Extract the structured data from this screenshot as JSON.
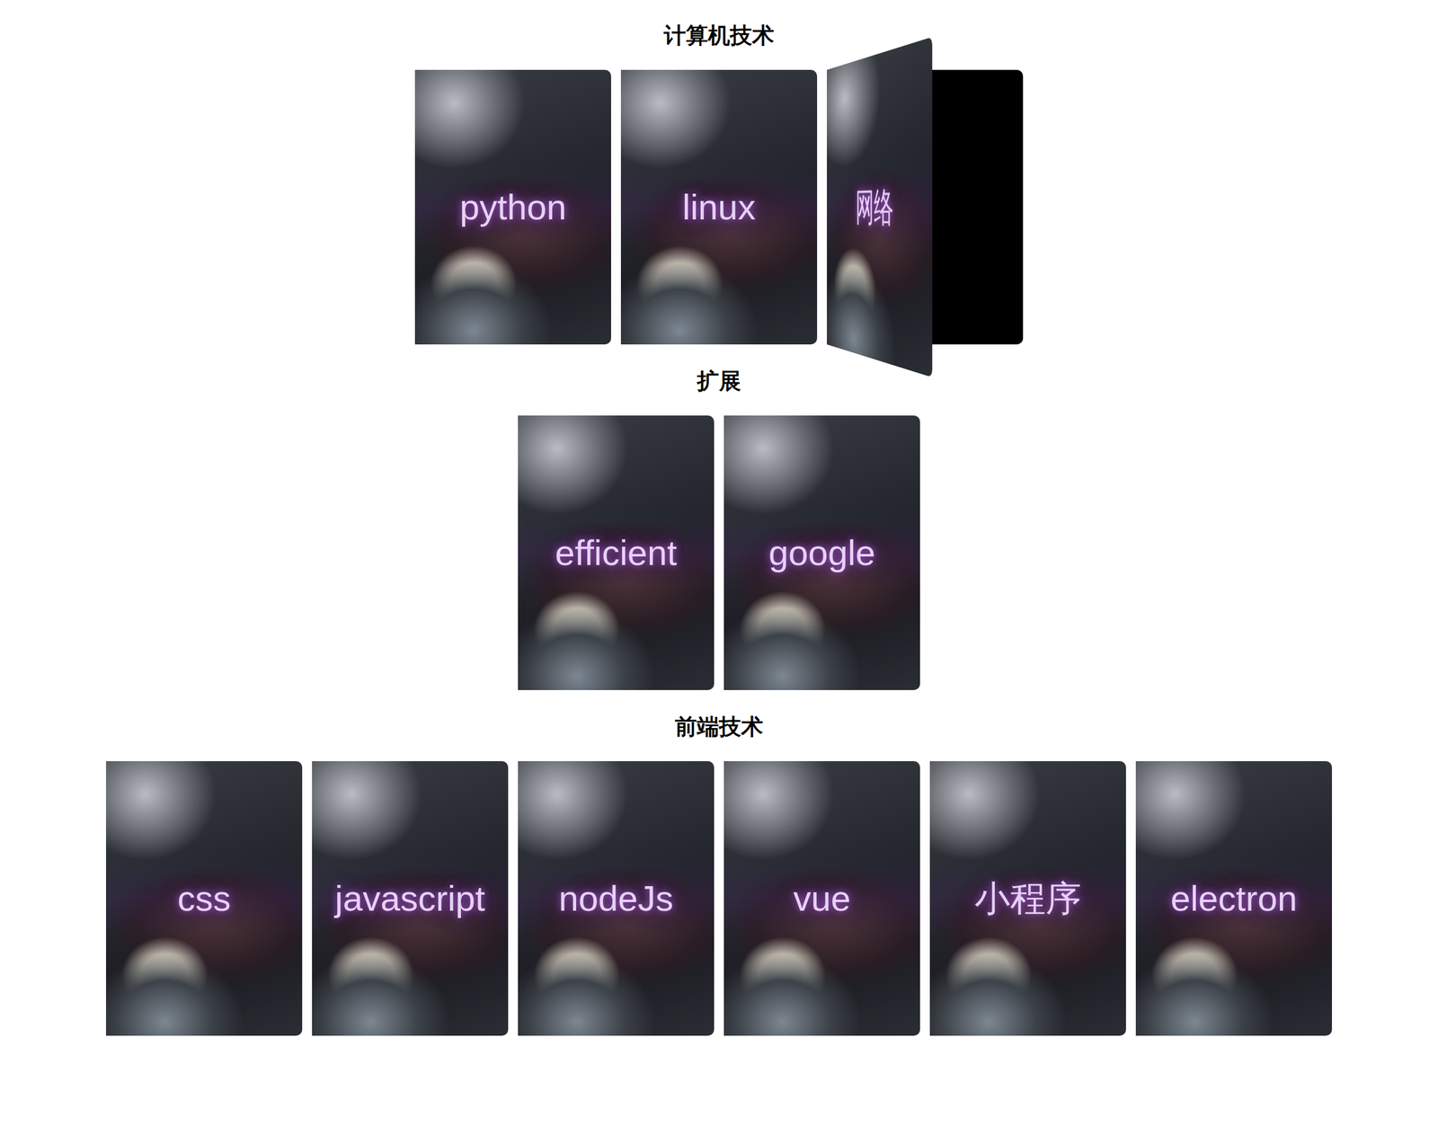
{
  "sections": [
    {
      "title": "计算机技术",
      "cards": [
        {
          "label": "python",
          "flipped": false
        },
        {
          "label": "linux",
          "flipped": false
        },
        {
          "label": "网络",
          "flipped": true
        }
      ]
    },
    {
      "title": "扩展",
      "cards": [
        {
          "label": "efficient",
          "flipped": false
        },
        {
          "label": "google",
          "flipped": false
        }
      ]
    },
    {
      "title": "前端技术",
      "cards": [
        {
          "label": "css",
          "flipped": false
        },
        {
          "label": "javascript",
          "flipped": false
        },
        {
          "label": "nodeJs",
          "flipped": false
        },
        {
          "label": "vue",
          "flipped": false
        },
        {
          "label": "小程序",
          "flipped": false
        },
        {
          "label": "electron",
          "flipped": false
        }
      ]
    }
  ]
}
